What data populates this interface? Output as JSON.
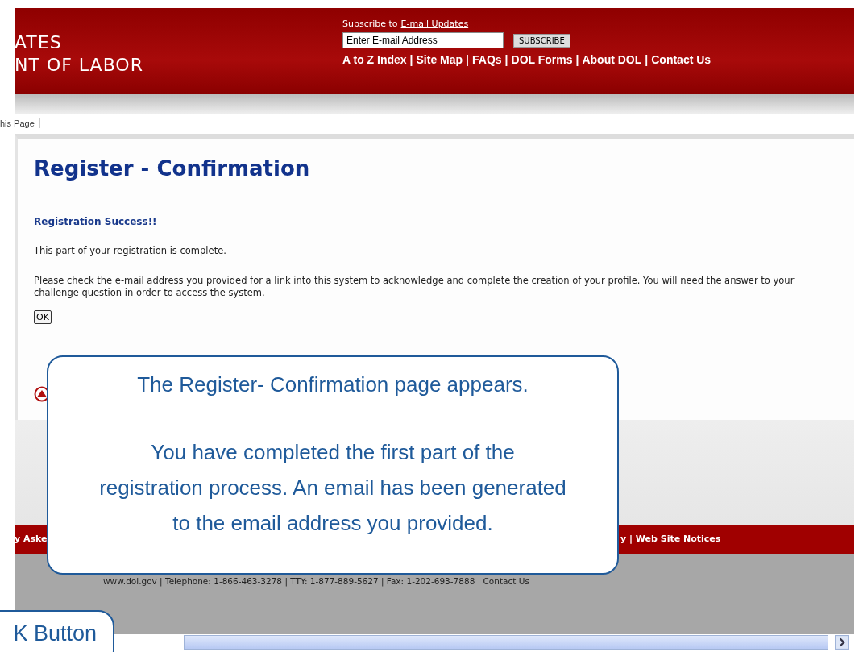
{
  "header": {
    "logo_lines": [
      "ATES",
      "NT OF LABOR"
    ],
    "subscribe_text": "Subscribe to",
    "subscribe_link": "E-mail Updates",
    "email_placeholder": "Enter E-mail Address",
    "subscribe_button": "SUBSCRIBE",
    "nav_separator": "|",
    "nav_links": [
      "A to Z Index",
      "Site Map",
      "FAQs",
      "DOL Forms",
      "About DOL",
      "Contact Us"
    ]
  },
  "tab": "his Page",
  "content": {
    "title": "Register - Confirmation",
    "subtitle": "Registration Success!!",
    "paragraphs": [
      "This part of your registration is complete.",
      "Please check the e-mail address you provided for a link into this system to acknowledge and complete the creation of your profile. You will need the answer to your challenge question in order to access the system."
    ],
    "ok_button": "OK"
  },
  "footer": {
    "nav_left": "y Aske",
    "nav_right": "y | Web Site Notices",
    "contact": "www.dol.gov | Telephone: 1-866-463-3278 | TTY: 1-877-889-5627 | Fax: 1-202-693-7888 | Contact Us"
  },
  "callouts": [
    {
      "paragraphs": [
        "The Register- Confirmation page appears.",
        "You have completed the first part of the registration process. An email has been generated to the email address you provided."
      ]
    },
    {
      "paragraphs": [
        "K Button"
      ]
    }
  ]
}
